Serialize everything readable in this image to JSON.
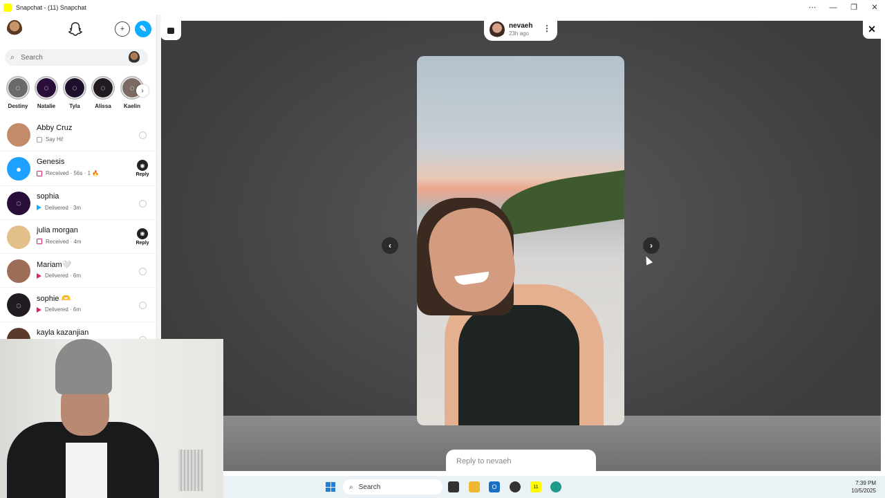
{
  "window": {
    "title": "Snapchat - (11) Snapchat"
  },
  "sidebar": {
    "search_placeholder": "Search",
    "stories": [
      {
        "name": "Destiny",
        "color": "#6a6a6a"
      },
      {
        "name": "Natalie",
        "color": "#2a0e3a"
      },
      {
        "name": "Tyla",
        "color": "#1e0f2a"
      },
      {
        "name": "Alissa",
        "color": "#231b22"
      },
      {
        "name": "Kaelin",
        "color": "#7a6a62"
      }
    ],
    "chats": [
      {
        "name": "Abby Cruz",
        "status": "Say Hi!",
        "status_color": "#9a9a9a",
        "action": "none",
        "avatar_color": "#c28b6a"
      },
      {
        "name": "Genesis",
        "status": "Received · 56s · 1 🔥",
        "status_color": "#e0245e",
        "action": "reply",
        "avatar_color": "#1ea0ff"
      },
      {
        "name": "sophia",
        "status": "Delivered · 3m",
        "status_color": "#0eadff",
        "action": "none",
        "avatar_color": "#2a0e3a"
      },
      {
        "name": "julia morgan",
        "status": "Received · 4m",
        "status_color": "#e0245e",
        "action": "reply",
        "avatar_color": "#e3c08a"
      },
      {
        "name": "Mariam🤍",
        "status": "Delivered · 6m",
        "status_color": "#e0245e",
        "action": "none",
        "avatar_color": "#9c6e57"
      },
      {
        "name": "sophie 🫶",
        "status": "Delivered · 6m",
        "status_color": "#e0245e",
        "action": "none",
        "avatar_color": "#231b22"
      },
      {
        "name": "kayla kazanjian",
        "status": "",
        "status_color": "#9a9a9a",
        "action": "none",
        "avatar_color": "#5a3a2a"
      }
    ],
    "reply_label": "Reply"
  },
  "story": {
    "username": "nevaeh",
    "time": "23h ago",
    "reply_placeholder": "Reply to nevaeh"
  },
  "taskbar": {
    "search_placeholder": "Search",
    "time": "7:39 PM",
    "date": "10/5/2025",
    "snapchat_badge": "11"
  }
}
